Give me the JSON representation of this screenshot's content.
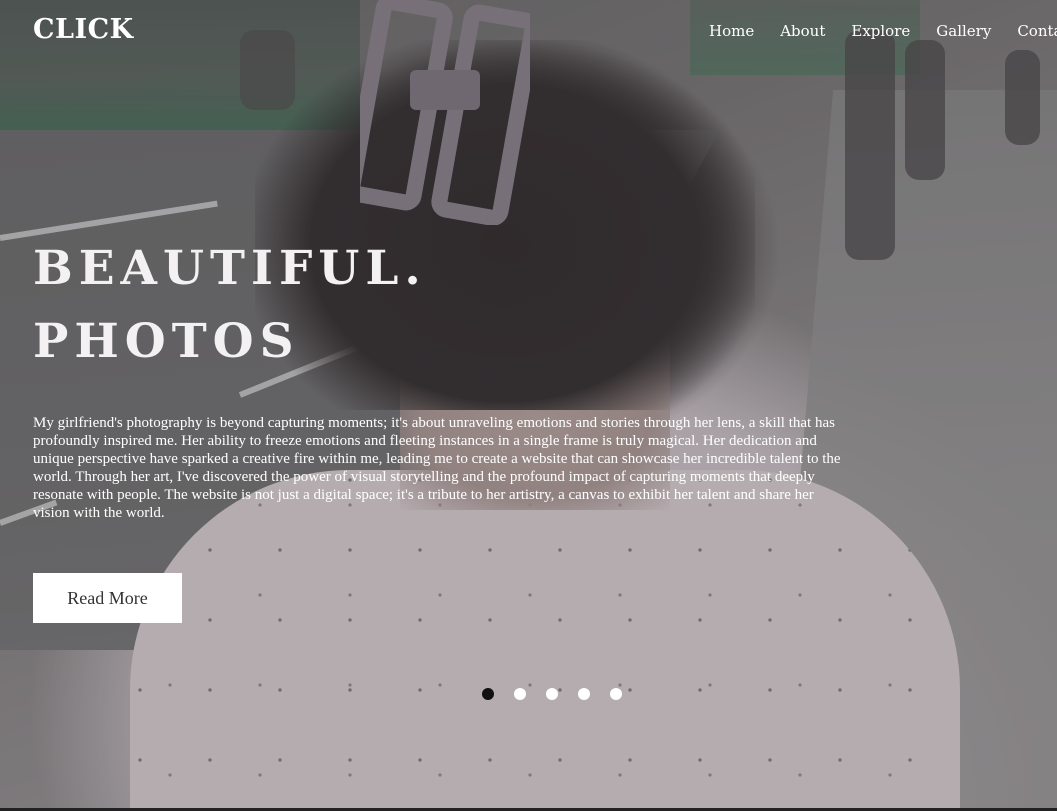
{
  "header": {
    "logo": "CLICK",
    "nav": [
      {
        "label": "Home"
      },
      {
        "label": "About"
      },
      {
        "label": "Explore"
      },
      {
        "label": "Gallery"
      },
      {
        "label": "Contact"
      }
    ]
  },
  "hero": {
    "headline_line1": "BEAUTIFUL.",
    "headline_line2": "PHOTOS",
    "description": "My girlfriend's photography is beyond capturing moments; it's about unraveling emotions and stories through her lens, a skill that has profoundly inspired me. Her ability to freeze emotions and fleeting instances in a single frame is truly magical. Her dedication and unique perspective have sparked a creative fire within me, leading me to create a website that can showcase her incredible talent to the world. Through her art, I've discovered the power of visual storytelling and the profound impact of capturing moments that deeply resonate with people. The website is not just a digital space; it's a tribute to her artistry, a canvas to exhibit her talent and share her vision with the world.",
    "read_more_label": "Read More"
  },
  "slider": {
    "slide_count": 5,
    "active_index": 0
  },
  "colors": {
    "text": "#ffffff",
    "button_bg": "#ffffff",
    "button_text": "#333333",
    "active_dot": "#111111"
  }
}
